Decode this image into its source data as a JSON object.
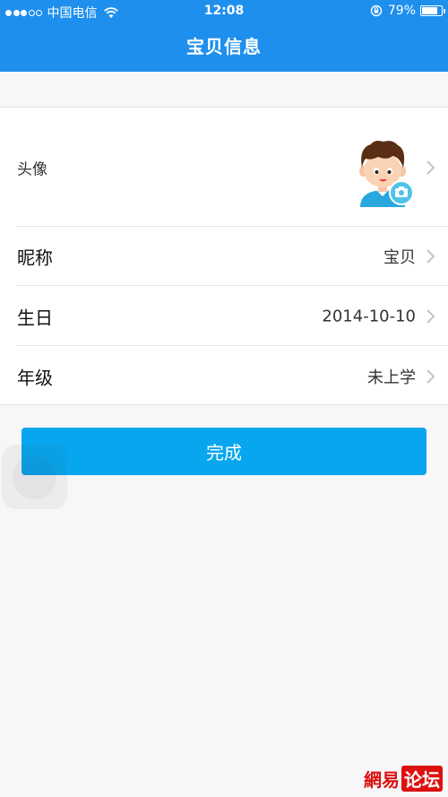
{
  "status_bar": {
    "carrier": "中国电信",
    "time": "12:08",
    "battery_percent": "79%",
    "battery_level": 0.79,
    "signal_bars_filled": 3,
    "signal_bars_total": 5
  },
  "nav": {
    "title": "宝贝信息"
  },
  "form": {
    "avatar_label": "头像",
    "nickname_label": "昵称",
    "nickname_value": "宝贝",
    "birthday_label": "生日",
    "birthday_value": "2014-10-10",
    "grade_label": "年级",
    "grade_value": "未上学"
  },
  "actions": {
    "done_label": "完成"
  },
  "watermark": {
    "part1": "網易",
    "part2": "论坛"
  },
  "colors": {
    "nav_bg": "#1e8fed",
    "button_bg": "#08a6ef",
    "page_bg": "#f7f7f9"
  }
}
